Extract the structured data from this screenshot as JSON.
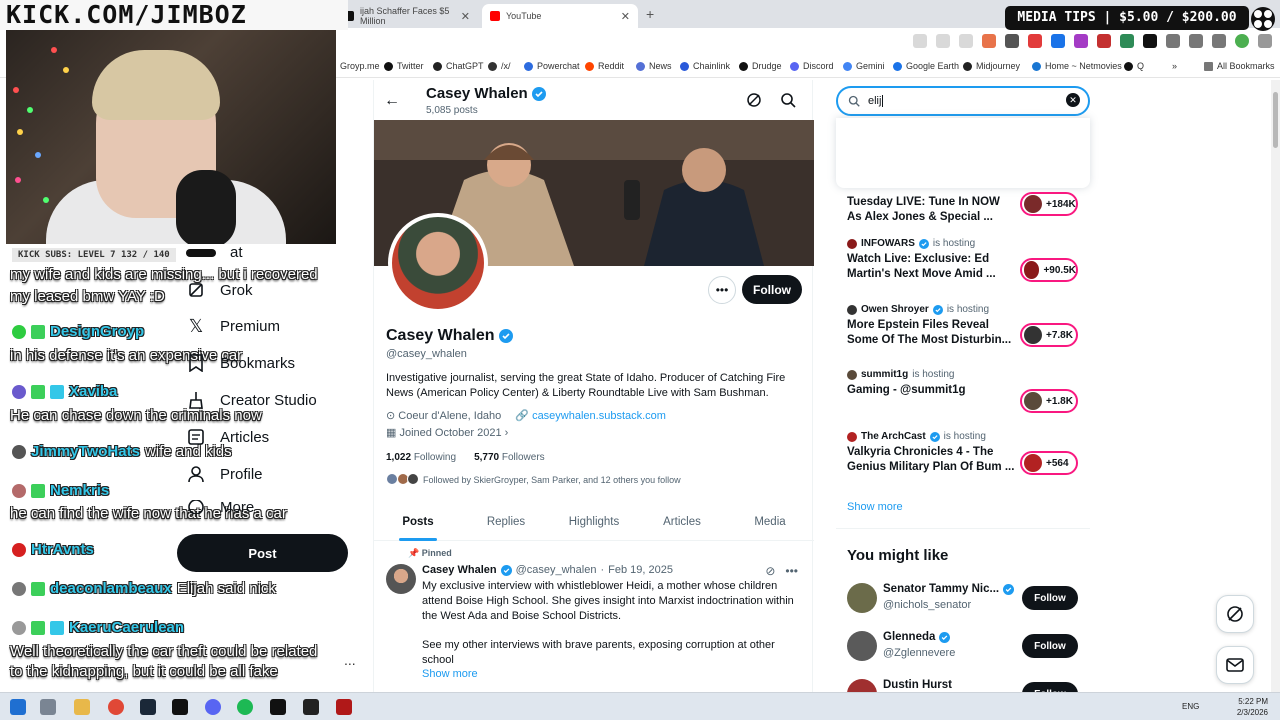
{
  "browser": {
    "tabs": [
      {
        "title": "ijah Schaffer Faces $5 Million",
        "color": "#111111"
      },
      {
        "title": "YouTube",
        "color": "#ff0000"
      }
    ],
    "new_tab_glyph": "+",
    "bookmarks": [
      {
        "label": "Groyp.me",
        "color": "#888888"
      },
      {
        "label": "Twitter",
        "color": "#111111"
      },
      {
        "label": "ChatGPT",
        "color": "#222222"
      },
      {
        "label": "/x/",
        "color": "#333333"
      },
      {
        "label": "Powerchat",
        "color": "#2d6cdf"
      },
      {
        "label": "Reddit",
        "color": "#ff4500"
      },
      {
        "label": "News",
        "color": "#5470d6"
      },
      {
        "label": "Chainlink",
        "color": "#2a5ada"
      },
      {
        "label": "Drudge",
        "color": "#111111"
      },
      {
        "label": "Discord",
        "color": "#5865f2"
      },
      {
        "label": "Gemini",
        "color": "#4285f4"
      },
      {
        "label": "Google Earth",
        "color": "#1a73e8"
      },
      {
        "label": "Midjourney",
        "color": "#222222"
      },
      {
        "label": "Home ~ Netmovies",
        "color": "#1976d2"
      },
      {
        "label": "Q",
        "color": "#111111"
      }
    ],
    "all_bookmarks_label": "All Bookmarks"
  },
  "overlay": {
    "kick_banner": "KICK.COM/JIMBOZ",
    "media_tips": "MEDIA TIPS | $5.00 / $200.00",
    "subs_bar": "KICK SUBS: LEVEL 7 132 / 140",
    "chat": {
      "messages": [
        {
          "text": "my wife and kids are missing... but i recovered"
        },
        {
          "text": "my leased bmw YAY :D"
        },
        {
          "user": "DesignGroyp",
          "badge": "#2ecc40"
        },
        {
          "text": "in his defense it's an expensive car"
        },
        {
          "user": "Xaviba",
          "badge": "#6a5acd"
        },
        {
          "text": "He can chase down the criminals now"
        },
        {
          "user": "JimmyTwoHats",
          "extra": "wife and kids",
          "badge": "#555555"
        },
        {
          "user": "Nemkris",
          "badge": "#b46a6a"
        },
        {
          "text": "he can find the wife now that he has a car"
        },
        {
          "user": "HtrAvnts",
          "badge": "#d62020"
        },
        {
          "user": "deaconlambeaux",
          "extra": "Elijah said nick",
          "badge": "#777777"
        },
        {
          "user": "KaeruCaerulean",
          "badge": "#999999"
        },
        {
          "text": "Well theoretically the car theft could be related"
        },
        {
          "text": "to the kidnapping, but it could be all fake"
        }
      ]
    }
  },
  "left_nav": {
    "partial_label": "at",
    "items": [
      {
        "label": "Grok",
        "icon": "grok-icon"
      },
      {
        "label": "Premium",
        "icon": "x-logo-icon"
      },
      {
        "label": "Bookmarks",
        "icon": "bookmark-icon"
      },
      {
        "label": "Creator Studio",
        "icon": "creator-studio-icon"
      },
      {
        "label": "Articles",
        "icon": "articles-icon"
      },
      {
        "label": "Profile",
        "icon": "profile-icon"
      },
      {
        "label": "More",
        "icon": "more-icon"
      }
    ],
    "post_button": "Post",
    "more_glyph": "..."
  },
  "profile": {
    "display_name": "Casey Whalen",
    "post_count": "5,085 posts",
    "handle": "@casey_whalen",
    "bio": "Investigative journalist, serving the great State of Idaho.  Producer of Catching Fire News (American Policy Center) & Liberty Roundtable Live with Sam Bushman.",
    "location": "Coeur d'Alene, Idaho",
    "website": "caseywhalen.substack.com",
    "joined": "Joined October 2021",
    "following_count": "1,022",
    "following_label": "Following",
    "followers_count": "5,770",
    "followers_label": "Followers",
    "followed_by": "Followed by SkierGroyper, Sam Parker, and 12 others you follow",
    "follow_button": "Follow",
    "tabs": [
      "Posts",
      "Replies",
      "Highlights",
      "Articles",
      "Media"
    ],
    "active_tab": "Posts",
    "pinned_label": "Pinned",
    "pinned_post": {
      "author": "Casey Whalen",
      "handle": "@casey_whalen",
      "date": "Feb 19, 2025",
      "text": "My exclusive interview with whistleblower Heidi, a mother whose children attend Boise High School.  She gives insight into Marxist indoctrination within the West Ada and Boise School Districts.",
      "text2": "See my other interviews with brave parents, exposing corruption at other school",
      "show_more": "Show more"
    }
  },
  "search": {
    "value": "elij"
  },
  "live": [
    {
      "host": "",
      "hosting_label": "",
      "title": "Tuesday LIVE: Tune In NOW As Alex Jones & Special ...",
      "count": "+184K",
      "color": "#7a2a2a"
    },
    {
      "host": "INFOWARS",
      "hosting_label": "is hosting",
      "title": "Watch Live: Exclusive: Ed Martin's Next Move Amid ...",
      "count": "+90.5K",
      "color": "#8a1a1a"
    },
    {
      "host": "Owen Shroyer",
      "hosting_label": "is hosting",
      "title": "More Epstein Files Reveal Some Of The Most Disturbin...",
      "count": "+7.8K",
      "color": "#333333"
    },
    {
      "host": "summit1g",
      "hosting_label": "is hosting",
      "title": "Gaming - @summit1g",
      "count": "+1.8K",
      "color": "#5a4a3a"
    },
    {
      "host": "The ArchCast",
      "hosting_label": "is hosting",
      "title": "Valkyria Chronicles 4 - The Genius Military Plan Of Bum ...",
      "count": "+564",
      "color": "#b22222"
    }
  ],
  "show_more_right": "Show more",
  "you_might_like": {
    "title": "You might like",
    "follow_label": "Follow",
    "people": [
      {
        "name": "Senator Tammy Nic...",
        "handle": "@nichols_senator",
        "color": "#6b6b4a"
      },
      {
        "name": "Glenneda",
        "handle": "@Zglennevere",
        "color": "#5a5a5a"
      },
      {
        "name": "Dustin Hurst",
        "handle": "",
        "color": "#a03030"
      }
    ]
  },
  "taskbar": {
    "language": "ENG",
    "time": "5:22 PM",
    "date": "2/3/2026"
  }
}
